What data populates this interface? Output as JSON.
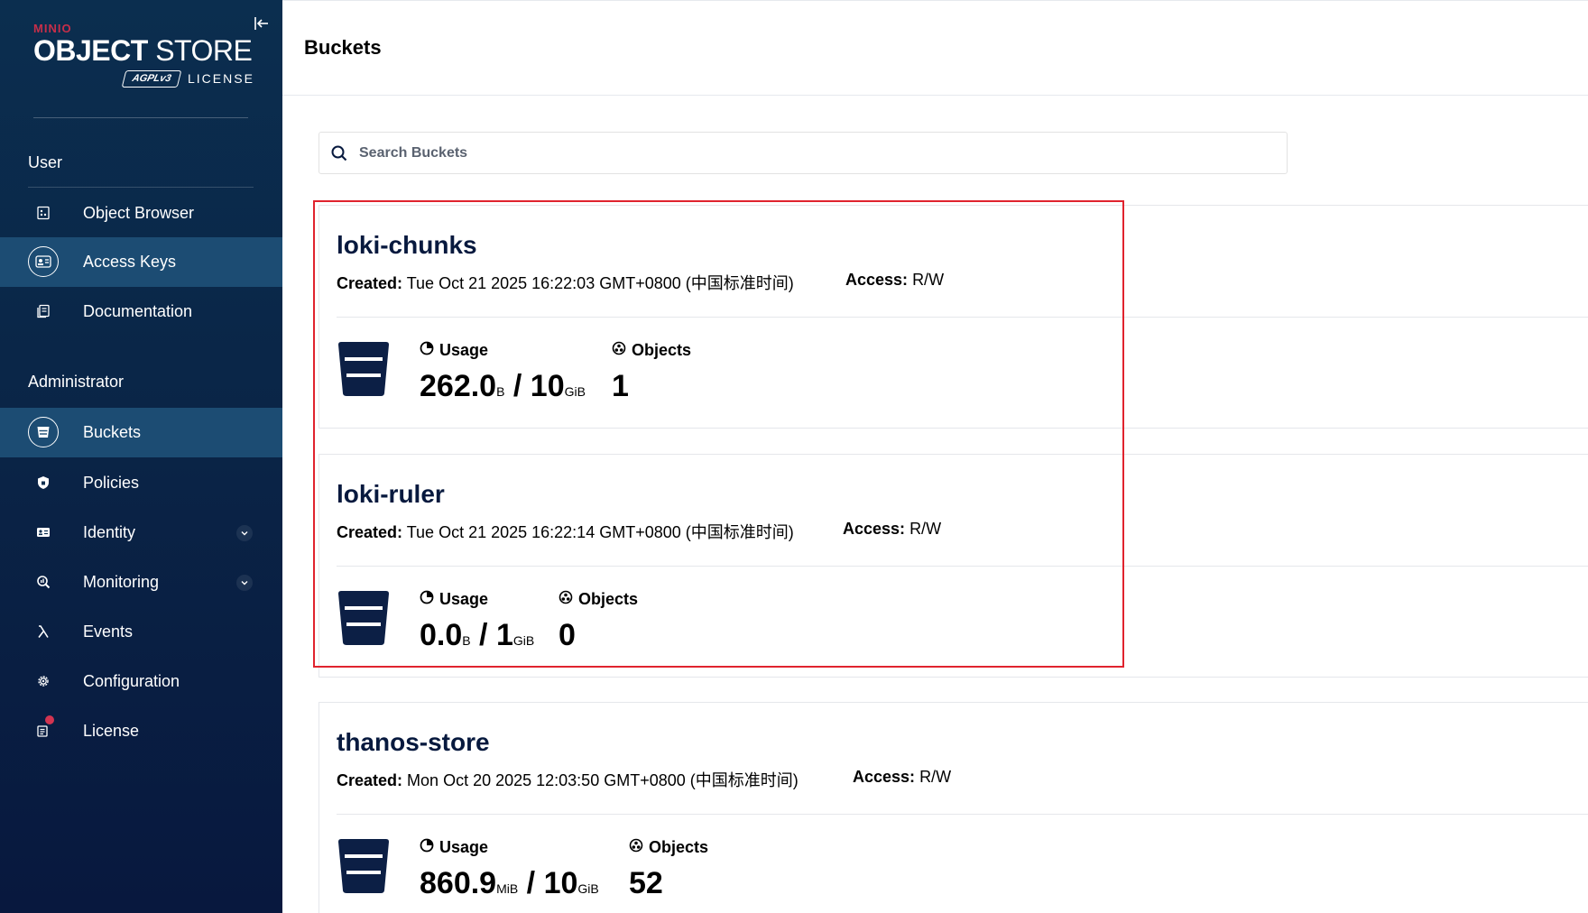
{
  "brand": {
    "minio": "MINIO",
    "title_bold": "OBJECT",
    "title_light": " STORE",
    "badge": "AGPLv3",
    "license": "LICENSE"
  },
  "sidebar": {
    "user_label": "User",
    "admin_label": "Administrator",
    "user_items": [
      {
        "label": "Object Browser",
        "icon": "object-browser-icon"
      },
      {
        "label": "Access Keys",
        "icon": "access-keys-icon"
      },
      {
        "label": "Documentation",
        "icon": "documentation-icon"
      }
    ],
    "admin_items": [
      {
        "label": "Buckets",
        "icon": "bucket-icon"
      },
      {
        "label": "Policies",
        "icon": "shield-icon"
      },
      {
        "label": "Identity",
        "icon": "id-card-icon"
      },
      {
        "label": "Monitoring",
        "icon": "magnifier-chart-icon"
      },
      {
        "label": "Events",
        "icon": "lambda-icon"
      },
      {
        "label": "Configuration",
        "icon": "gear-icon"
      },
      {
        "label": "License",
        "icon": "license-icon"
      }
    ],
    "active_item": "Buckets"
  },
  "page": {
    "title": "Buckets"
  },
  "search": {
    "placeholder": "Search Buckets",
    "value": ""
  },
  "labels": {
    "created": "Created:",
    "access": "Access:",
    "usage": "Usage",
    "objects": "Objects",
    "slash": " / "
  },
  "buckets": [
    {
      "name": "loki-chunks",
      "created": "Tue Oct 21 2025 16:22:03 GMT+0800 (中国标准时间)",
      "access": "R/W",
      "usage_value": "262.0",
      "usage_unit": "B",
      "quota_value": "10",
      "quota_unit": "GiB",
      "objects": "1"
    },
    {
      "name": "loki-ruler",
      "created": "Tue Oct 21 2025 16:22:14 GMT+0800 (中国标准时间)",
      "access": "R/W",
      "usage_value": "0.0",
      "usage_unit": "B",
      "quota_value": "1",
      "quota_unit": "GiB",
      "objects": "0"
    },
    {
      "name": "thanos-store",
      "created": "Mon Oct 20 2025 12:03:50 GMT+0800 (中国标准时间)",
      "access": "R/W",
      "usage_value": "860.9",
      "usage_unit": "MiB",
      "quota_value": "10",
      "quota_unit": "GiB",
      "objects": "52"
    }
  ],
  "colors": {
    "sidebar": "#0b2e4f",
    "sidebar_active": "#1c4c73",
    "accent_red": "#c72e49",
    "highlight_border": "#e0232e",
    "text_dark": "#07193e"
  }
}
